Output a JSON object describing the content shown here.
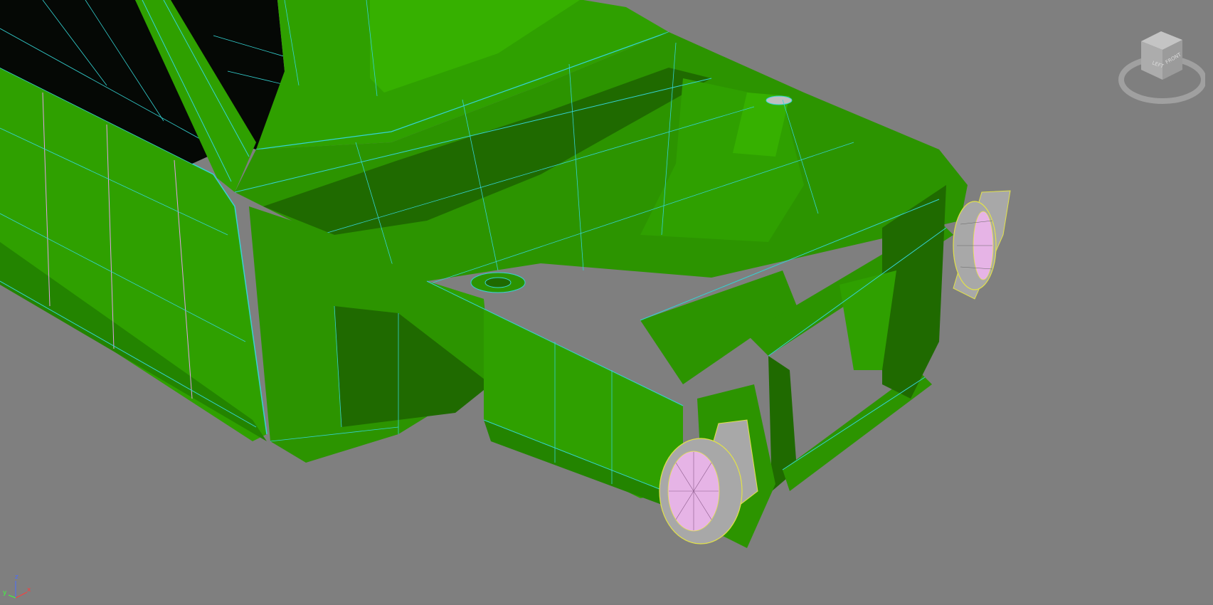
{
  "viewport": {
    "name": "perspective-viewport",
    "background_color": "#7f7f7f",
    "model": {
      "subject": "car front chassis mesh",
      "display_mode": "shaded with edged faces",
      "body_color": "#2fa000",
      "shadow_color": "#1f6a00",
      "wire_color": "#34d4d4",
      "selected_wire_color": "#e2e24a",
      "interior_color": "#000000",
      "headlight_lens_color": "#e6b4e6",
      "headlight_housing_color": "#a8a8a8"
    },
    "viewcube": {
      "faces": [
        "LEFT",
        "FRONT"
      ],
      "color": "#b4b4b4"
    },
    "axis_tripod": {
      "x": "x",
      "y": "y",
      "z": "z",
      "colors": {
        "x": "#ff3c3c",
        "y": "#3cff3c",
        "z": "#4a6cff"
      }
    }
  }
}
